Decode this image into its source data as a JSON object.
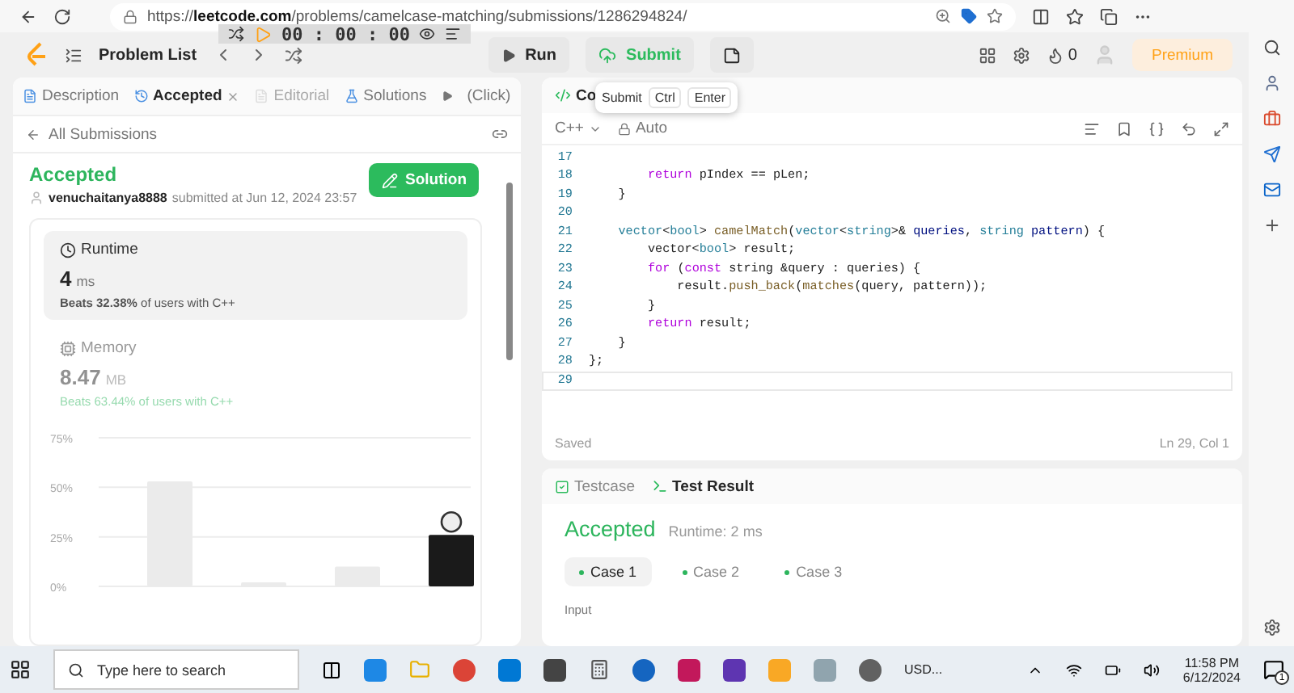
{
  "browser": {
    "url": "https://**leetcode.com**/problems/camelcase-matching/submissions/1286294824/"
  },
  "header": {
    "problem_list": "Problem List",
    "timer": "00 : 00 : 00",
    "run": "Run",
    "submit": "Submit",
    "streak": "0",
    "premium": "Premium"
  },
  "tooltip": {
    "label": "Submit",
    "keys": [
      "Ctrl",
      "Enter"
    ]
  },
  "left_tabs": [
    {
      "label": "Description",
      "selected": false,
      "disabled": false
    },
    {
      "label": "Accepted",
      "selected": true,
      "disabled": false
    },
    {
      "label": "Editorial",
      "selected": false,
      "disabled": true
    },
    {
      "label": "Solutions",
      "selected": false,
      "disabled": false
    }
  ],
  "left_tabs_extra": "(Click)",
  "submission": {
    "back": "All Submissions",
    "status": "Accepted",
    "user": "venuchaitanya8888",
    "submitted": "submitted at Jun 12, 2024 23:57",
    "solution_button": "Solution"
  },
  "stats": [
    {
      "kind": "runtime",
      "title": "Runtime",
      "value": "4",
      "unit": "ms",
      "beats": "**Beats 32.38%** of users with C++",
      "selected": true
    },
    {
      "kind": "memory",
      "title": "Memory",
      "value": "8.47",
      "unit": "MB",
      "beats": "Beats 63.44% of users with C++",
      "selected": false
    }
  ],
  "chart_data": {
    "type": "bar",
    "series": [
      {
        "color": "#ebebeb",
        "values": [
          53,
          2,
          10,
          null
        ]
      },
      {
        "color": "#1a1a1a",
        "values": [
          null,
          null,
          null,
          26
        ]
      }
    ],
    "ylim": [
      0,
      75
    ],
    "yticks": [
      {
        "value": 0,
        "label": "0%"
      },
      {
        "value": 25,
        "label": "25%"
      },
      {
        "value": 50,
        "label": "50%"
      },
      {
        "value": 75,
        "label": "75%"
      }
    ]
  },
  "editor": {
    "tab": "Co",
    "language": "C++",
    "mode": "Auto",
    "status": "Saved",
    "cursor": "Ln 29, Col 1",
    "lines": [
      {
        "number": "17",
        "current": false
      },
      {
        "number": "18",
        "current": false,
        "tokens": [
          {
            "text": "        return",
            "kind": "kw"
          },
          {
            "text": " pIndex == pLen;",
            "kind": "plain"
          }
        ]
      },
      {
        "number": "19",
        "current": false,
        "tokens": [
          {
            "text": "    }",
            "kind": "plain"
          }
        ]
      },
      {
        "number": "20",
        "current": false
      },
      {
        "number": "21",
        "current": false,
        "tokens": [
          {
            "text": "    vector",
            "kind": "type"
          },
          {
            "text": "<",
            "kind": "plain"
          },
          {
            "text": "bool",
            "kind": "type"
          },
          {
            "text": "> ",
            "kind": "plain"
          },
          {
            "text": "camelMatch",
            "kind": "fn"
          },
          {
            "text": "(",
            "kind": "plain"
          },
          {
            "text": "vector",
            "kind": "type"
          },
          {
            "text": "<",
            "kind": "plain"
          },
          {
            "text": "string",
            "kind": "type"
          },
          {
            "text": ">& ",
            "kind": "plain"
          },
          {
            "text": "queries",
            "kind": "var"
          },
          {
            "text": ", ",
            "kind": "plain"
          },
          {
            "text": "string ",
            "kind": "type"
          },
          {
            "text": "pattern",
            "kind": "var"
          },
          {
            "text": ") {",
            "kind": "plain"
          }
        ]
      },
      {
        "number": "22",
        "current": false,
        "tokens": [
          {
            "text": "        vector<",
            "kind": "plain"
          },
          {
            "text": "bool",
            "kind": "type"
          },
          {
            "text": "> result;",
            "kind": "plain"
          }
        ]
      },
      {
        "number": "23",
        "current": false,
        "tokens": [
          {
            "text": "        for",
            "kind": "kw"
          },
          {
            "text": " (",
            "kind": "plain"
          },
          {
            "text": "const",
            "kind": "kw"
          },
          {
            "text": " string &query : queries) {",
            "kind": "plain"
          }
        ]
      },
      {
        "number": "24",
        "current": false,
        "tokens": [
          {
            "text": "            result.",
            "kind": "plain"
          },
          {
            "text": "push_back",
            "kind": "fn"
          },
          {
            "text": "(",
            "kind": "plain"
          },
          {
            "text": "matches",
            "kind": "fn"
          },
          {
            "text": "(query, pattern));",
            "kind": "plain"
          }
        ]
      },
      {
        "number": "25",
        "current": false,
        "tokens": [
          {
            "text": "        }",
            "kind": "plain"
          }
        ]
      },
      {
        "number": "26",
        "current": false,
        "tokens": [
          {
            "text": "        return",
            "kind": "kw"
          },
          {
            "text": " result;",
            "kind": "plain"
          }
        ]
      },
      {
        "number": "27",
        "current": false,
        "tokens": [
          {
            "text": "    }",
            "kind": "plain"
          }
        ]
      },
      {
        "number": "28",
        "current": false,
        "tokens": [
          {
            "text": "};",
            "kind": "plain"
          }
        ]
      },
      {
        "number": "29",
        "current": true
      }
    ]
  },
  "test": {
    "tabs": [
      {
        "label": "Testcase",
        "selected": false
      },
      {
        "label": "Test Result",
        "selected": true
      }
    ],
    "result": "Accepted",
    "runtime": "Runtime: 2 ms",
    "cases": [
      {
        "label": "Case 1",
        "selected": true
      },
      {
        "label": "Case 2",
        "selected": false
      },
      {
        "label": "Case 3",
        "selected": false
      }
    ],
    "input_label": "Input"
  },
  "taskbar": {
    "search": "Type here to search",
    "app_label": "USD...",
    "time": "11:58 PM",
    "date": "6/12/2024",
    "badge": "1"
  }
}
